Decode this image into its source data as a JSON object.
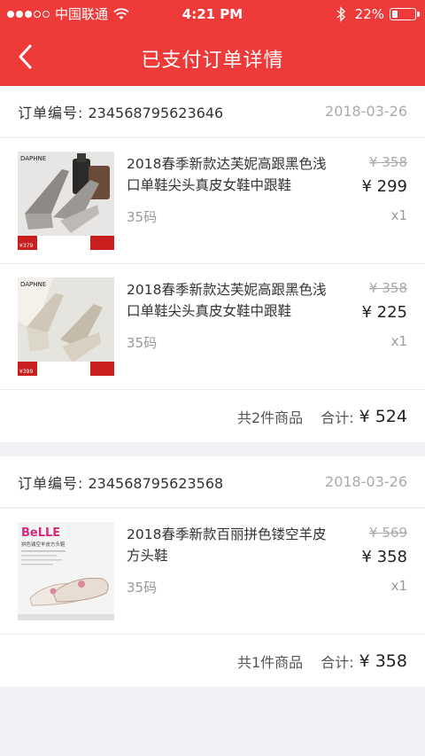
{
  "status_bar": {
    "carrier": "中国联通",
    "time": "4:21 PM",
    "battery": "22%",
    "battery_level": 0.22
  },
  "nav": {
    "title": "已支付订单详情",
    "back_icon": "chevron-left-icon"
  },
  "orders": [
    {
      "label": "订单编号:",
      "number": "234568795623646",
      "date": "2018-03-26",
      "items": [
        {
          "title": "2018春季新款达芙妮高跟黑色浅口单鞋尖头真皮女鞋中跟鞋",
          "size": "35码",
          "old_price": "¥ 358",
          "price": "¥ 299",
          "qty": "x1",
          "brand": "DAPHNE",
          "promo_price": "¥379"
        },
        {
          "title": "2018春季新款达芙妮高跟黑色浅口单鞋尖头真皮女鞋中跟鞋",
          "size": "35码",
          "old_price": "¥ 358",
          "price": "¥ 225",
          "qty": "x1",
          "brand": "DAPHNE",
          "promo_price": "¥399"
        }
      ],
      "count_text": "共2件商品",
      "total_label": "合计:",
      "total": "¥ 524"
    },
    {
      "label": "订单编号:",
      "number": "234568795623568",
      "date": "2018-03-26",
      "items": [
        {
          "title": "2018春季新款百丽拼色镂空羊皮方头鞋",
          "size": "35码",
          "old_price": "¥ 569",
          "price": "¥ 358",
          "qty": "x1",
          "brand": "BeLLE",
          "tagline": "拼色镂空羊皮方头鞋"
        }
      ],
      "count_text": "共1件商品",
      "total_label": "合计:",
      "total": "¥ 358"
    }
  ],
  "colors": {
    "brand": "#ef3a3a",
    "background": "#f1f2f5"
  }
}
